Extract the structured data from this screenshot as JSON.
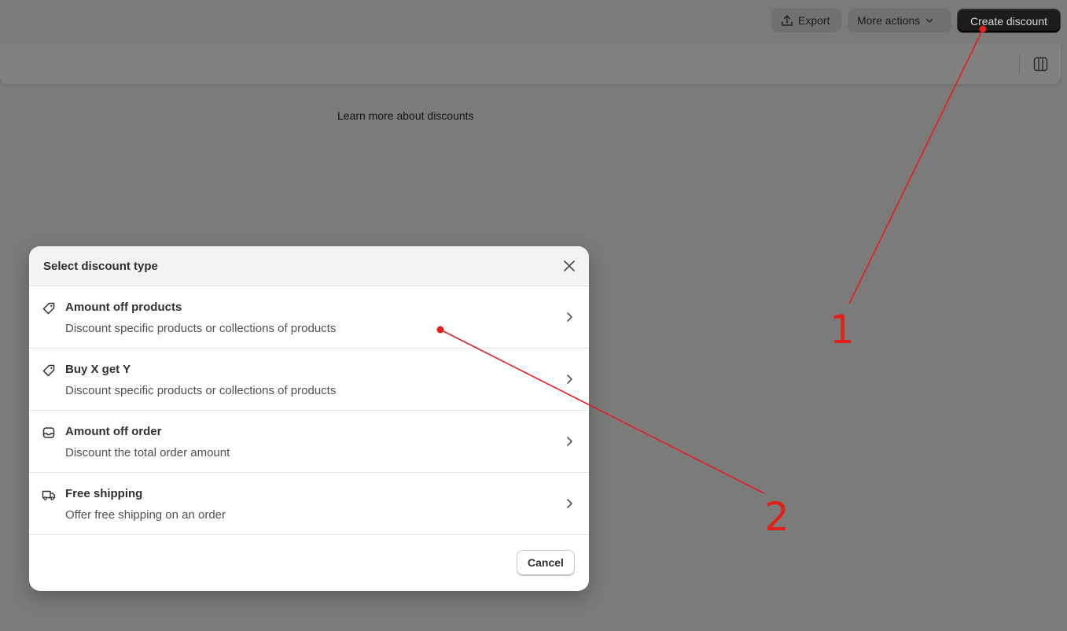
{
  "toolbar": {
    "export_label": "Export",
    "more_actions_label": "More actions",
    "create_discount_label": "Create discount"
  },
  "main": {
    "learn_more_text": "Learn more about discounts"
  },
  "modal": {
    "title": "Select discount type",
    "options": [
      {
        "title": "Amount off products",
        "description": "Discount specific products or collections of products",
        "icon": "tag-icon"
      },
      {
        "title": "Buy X get Y",
        "description": "Discount specific products or collections of products",
        "icon": "tag-icon"
      },
      {
        "title": "Amount off order",
        "description": "Discount the total order amount",
        "icon": "inbox-icon"
      },
      {
        "title": "Free shipping",
        "description": "Offer free shipping on an order",
        "icon": "truck-icon"
      }
    ],
    "cancel_label": "Cancel"
  },
  "annotations": {
    "step_1": "1",
    "step_2": "2",
    "color": "#e4201b"
  }
}
